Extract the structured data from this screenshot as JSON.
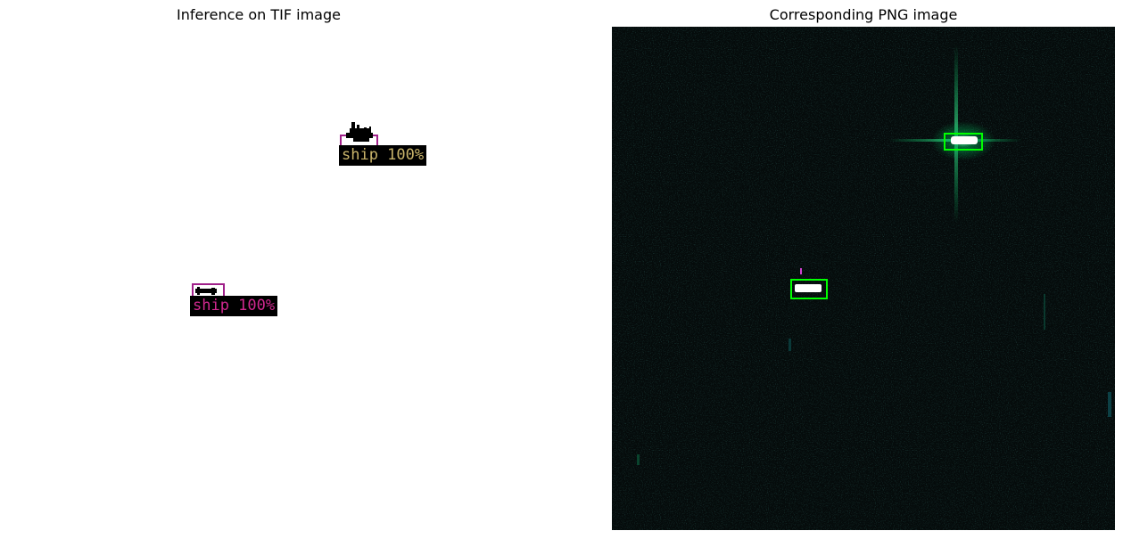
{
  "panels": {
    "left": {
      "title": "Inference on TIF image"
    },
    "right": {
      "title": "Corresponding PNG image"
    }
  },
  "detections": [
    {
      "label": "ship 100%",
      "label_color": "#c9b46a",
      "box_color": "#a0208a"
    },
    {
      "label": "ship 100%",
      "label_color": "#d0288f",
      "box_color": "#a0208a"
    }
  ],
  "colors": {
    "png_background": "#050b0b",
    "png_box": "#00ff00"
  }
}
